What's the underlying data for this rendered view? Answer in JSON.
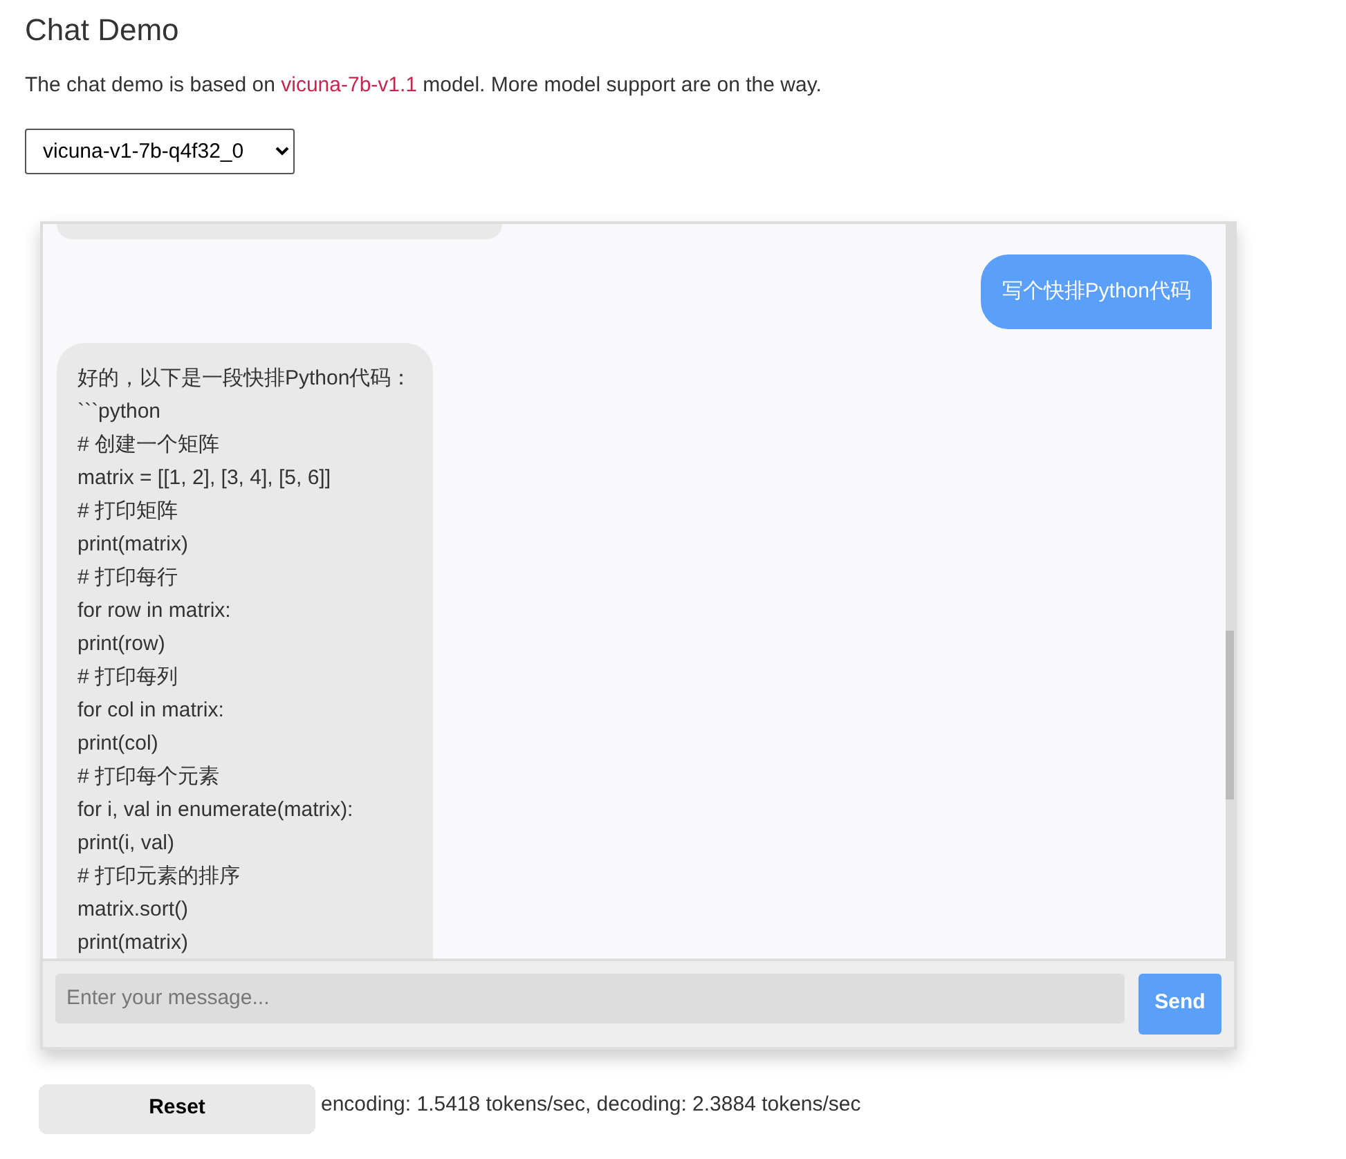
{
  "title": "Chat Demo",
  "intro": {
    "before": "The chat demo is based on ",
    "link": "vicuna-7b-v1.1",
    "after": " model. More model support are on the way."
  },
  "model_select": {
    "value": "vicuna-v1-7b-q4f32_0"
  },
  "messages": [
    {
      "kind": "user",
      "lines": [
        "写个快排Python代码"
      ]
    },
    {
      "kind": "bot",
      "lines": [
        "好的，以下是一段快排Python代码：",
        "```python",
        "# 创建一个矩阵",
        "matrix = [[1, 2], [3, 4], [5, 6]]",
        "# 打印矩阵",
        "print(matrix)",
        "# 打印每行",
        "for row in matrix:",
        "print(row)",
        "# 打印每列",
        "for col in matrix:",
        "print(col)",
        "# 打印每个元素",
        "for i, val in enumerate(matrix):",
        "print(i, val)",
        "# 打印元素的排序",
        "matrix.sort()",
        "print(matrix)"
      ]
    }
  ],
  "input": {
    "placeholder": "Enter your message..."
  },
  "send_button": "Send",
  "reset_button": "Reset",
  "stats": "encoding: 1.5418 tokens/sec, decoding: 2.3884 tokens/sec"
}
